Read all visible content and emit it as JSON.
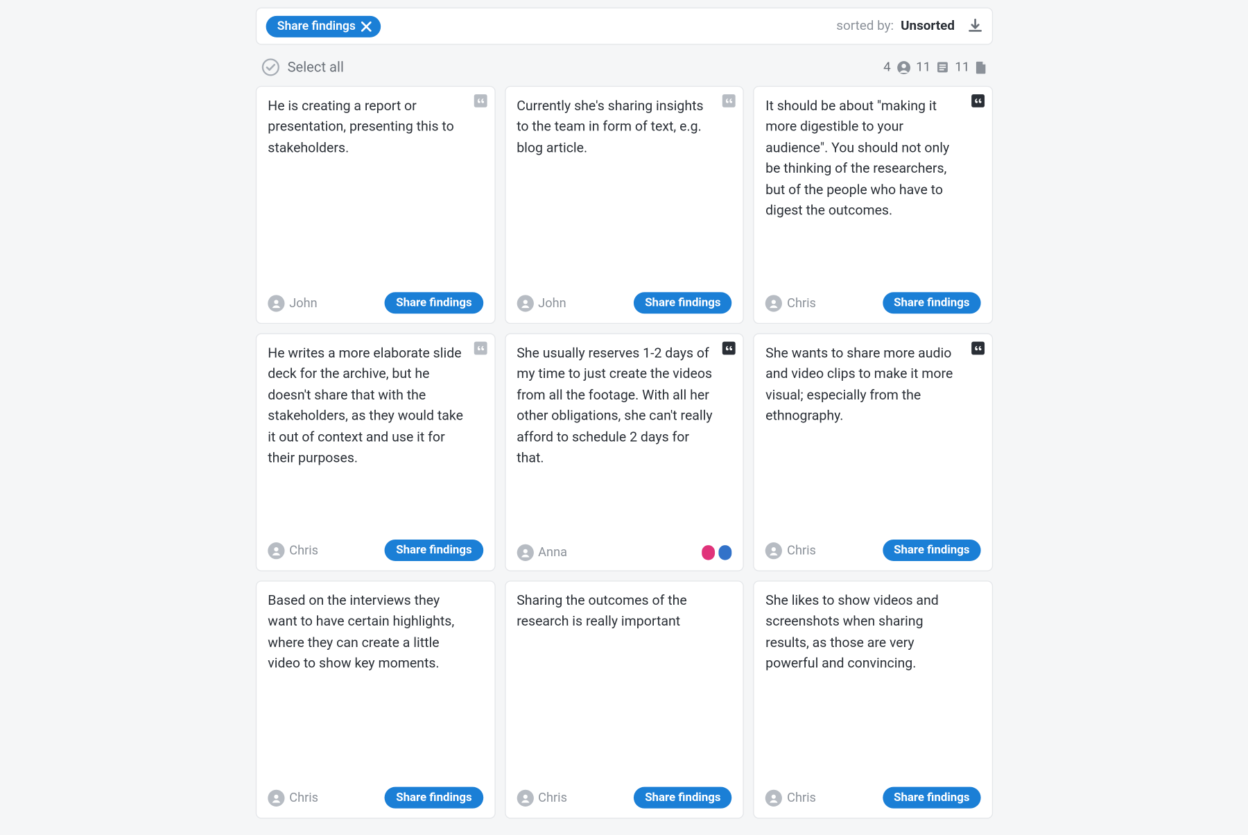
{
  "filter": {
    "chip_label": "Share findings",
    "sorted_by_label": "sorted by:",
    "sorted_by_value": "Unsorted"
  },
  "select_row": {
    "select_all_label": "Select all",
    "count_people": "4",
    "count_notes": "11",
    "count_docs": "11"
  },
  "tag_label": "Share findings",
  "cards": [
    {
      "text": "He is creating a report or presentation, presenting this to stakeholders.",
      "author": "John",
      "badge": "gray",
      "footer": "tag"
    },
    {
      "text": "Currently she's sharing insights to the team in form of text, e.g. blog article.",
      "author": "John",
      "badge": "gray",
      "footer": "tag"
    },
    {
      "text": "It should be about \"making it more digestible to your audience\". You should not only be thinking of the researchers, but of the people who have to digest the outcomes.",
      "author": "Chris",
      "badge": "dark",
      "footer": "tag"
    },
    {
      "text": "He writes a more elaborate slide deck for the archive, but he doesn't share that with the stakeholders, as they would take it out of context and use it for their purposes.",
      "author": "Chris",
      "badge": "gray",
      "footer": "tag"
    },
    {
      "text": "She usually reserves 1-2 days of my time to just create the videos from all the footage. With all her other obligations, she can't really afford to schedule 2 days for that.",
      "author": "Anna",
      "badge": "dark",
      "footer": "dots"
    },
    {
      "text": "She wants to share more audio and video clips to make it more visual; especially from the ethnography.",
      "author": "Chris",
      "badge": "dark",
      "footer": "tag"
    },
    {
      "text": "Based on the interviews they want to have certain highlights, where they can create a little video to show key moments.",
      "author": "Chris",
      "badge": "none",
      "footer": "tag"
    },
    {
      "text": "Sharing the outcomes of the research is really important",
      "author": "Chris",
      "badge": "none",
      "footer": "tag"
    },
    {
      "text": "She likes to show videos and screenshots when sharing results, as those are very powerful and convincing.",
      "author": "Chris",
      "badge": "none",
      "footer": "tag"
    }
  ]
}
